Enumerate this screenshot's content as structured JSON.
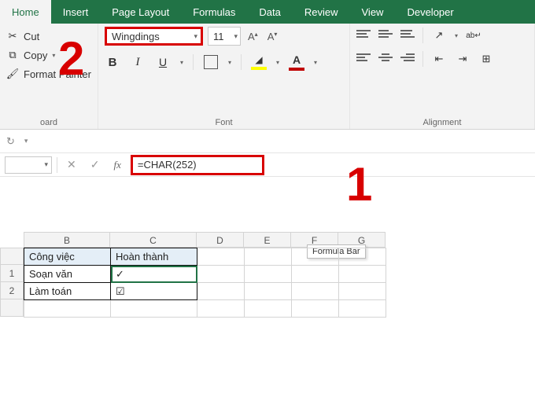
{
  "tabs": [
    "Home",
    "Insert",
    "Page Layout",
    "Formulas",
    "Data",
    "Review",
    "View",
    "Developer"
  ],
  "active_tab": 0,
  "clipboard": {
    "cut": "Cut",
    "copy": "Copy",
    "format_painter": "Format Painter",
    "group_label": "oard"
  },
  "font": {
    "name": "Wingdings",
    "size": "11",
    "group_label": "Font"
  },
  "alignment": {
    "group_label": "Alignment"
  },
  "formula_bar": {
    "fx": "fx",
    "formula": "=CHAR(252)",
    "tooltip": "Formula Bar"
  },
  "callouts": {
    "one": "1",
    "two": "2"
  },
  "grid": {
    "columns": [
      "B",
      "C",
      "D",
      "E",
      "F",
      "G"
    ],
    "row_nums": [
      "",
      "1",
      "2",
      ""
    ],
    "headers": {
      "B": "Công việc",
      "C": "Hoàn thành"
    },
    "rows": [
      {
        "B": "Soạn văn",
        "C": "✓"
      },
      {
        "B": "Làm toán",
        "C": "☑"
      }
    ]
  }
}
